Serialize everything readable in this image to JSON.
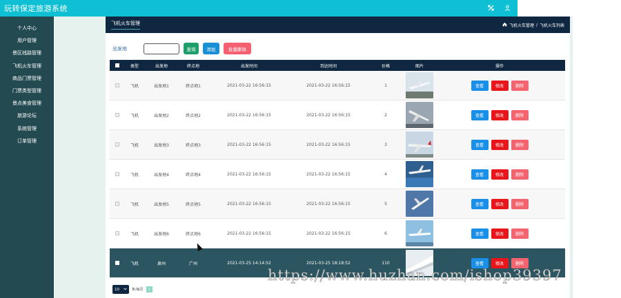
{
  "app": {
    "title": "玩转保定旅游系统",
    "colors": {
      "topbar": "#0fc0d4",
      "sidebar": "#234a51",
      "header": "#0f2740",
      "accent": "#1990d5"
    }
  },
  "topbar": {
    "icons": [
      "expand-icon",
      "user-icon"
    ]
  },
  "sidebar": {
    "items": [
      {
        "label": "个人中心"
      },
      {
        "label": "用户管理"
      },
      {
        "label": "景区线路管理"
      },
      {
        "label": "飞机火车管理"
      },
      {
        "label": "商品门票管理"
      },
      {
        "label": "门票类型管理"
      },
      {
        "label": "景点美食管理"
      },
      {
        "label": "旅游论坛"
      },
      {
        "label": "系统管理"
      },
      {
        "label": "订单管理"
      }
    ]
  },
  "header": {
    "tab": "飞机火车管理",
    "breadcrumb": [
      "飞机火车管理",
      "/",
      "飞机火车列表"
    ]
  },
  "search": {
    "label": "出发地",
    "value": "",
    "query_label": "查询",
    "add_label": "添加",
    "batch_delete_label": "批量删除"
  },
  "table": {
    "columns": [
      "类型",
      "出发地",
      "终点地",
      "出发时间",
      "到达时间",
      "价格",
      "图片",
      "操作"
    ],
    "rows": [
      {
        "type": "飞机",
        "departure": "出发地1",
        "destination": "终点地1",
        "depart_time": "2021-03-22 16:56:15",
        "arrive_time": "2021-03-22 16:56:15",
        "price": "1"
      },
      {
        "type": "飞机",
        "departure": "出发地2",
        "destination": "终点地2",
        "depart_time": "2021-03-22 16:56:15",
        "arrive_time": "2021-03-22 16:56:15",
        "price": "2"
      },
      {
        "type": "飞机",
        "departure": "出发地3",
        "destination": "终点地3",
        "depart_time": "2021-03-22 16:56:15",
        "arrive_time": "2021-03-22 16:56:15",
        "price": "3"
      },
      {
        "type": "飞机",
        "departure": "出发地4",
        "destination": "终点地4",
        "depart_time": "2021-03-22 16:56:15",
        "arrive_time": "2021-03-22 16:56:15",
        "price": "4"
      },
      {
        "type": "飞机",
        "departure": "出发地5",
        "destination": "终点地5",
        "depart_time": "2021-03-22 16:56:15",
        "arrive_time": "2021-03-22 16:56:15",
        "price": "5"
      },
      {
        "type": "飞机",
        "departure": "出发地6",
        "destination": "终点地6",
        "depart_time": "2021-03-22 16:56:15",
        "arrive_time": "2021-03-22 16:56:15",
        "price": "6"
      },
      {
        "type": "飞机",
        "departure": "泉州",
        "destination": "广州",
        "depart_time": "2021-03-25 14:14:52",
        "arrive_time": "2021-03-25 18:18:52",
        "price": "110"
      }
    ],
    "ops": {
      "view": "查看",
      "edit": "修改",
      "delete": "删除"
    }
  },
  "pager": {
    "page_size": "10",
    "per_label": "条/每页",
    "page": "1"
  },
  "watermark": "https://www.huzhan.com/ishop39397"
}
